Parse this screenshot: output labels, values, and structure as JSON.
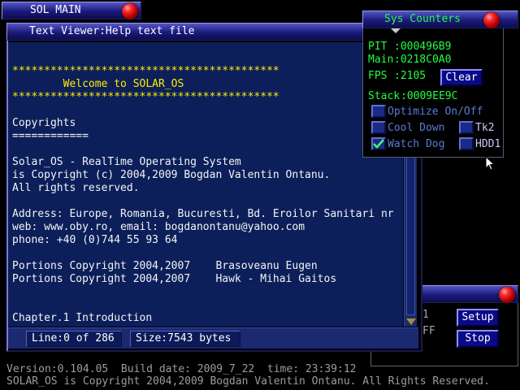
{
  "sol_main": {
    "title": "SOL MAIN"
  },
  "viewer": {
    "title": "Text Viewer:Help text file",
    "lines": [
      {
        "text": "******************************************",
        "color": "yellow"
      },
      {
        "text": "        Welcome to SOLAR_OS",
        "color": "yellow"
      },
      {
        "text": "******************************************",
        "color": "yellow"
      },
      {
        "text": "",
        "color": "white"
      },
      {
        "text": "Copyrights",
        "color": "white"
      },
      {
        "text": "============",
        "color": "white"
      },
      {
        "text": "",
        "color": "white"
      },
      {
        "text": "Solar_OS - RealTime Operating System",
        "color": "white"
      },
      {
        "text": "is Copyright (c) 2004,2009 Bogdan Valentin Ontanu.",
        "color": "white"
      },
      {
        "text": "All rights reserved.",
        "color": "white"
      },
      {
        "text": "",
        "color": "white"
      },
      {
        "text": "Address: Europe, Romania, Bucuresti, Bd. Eroilor Sanitari nr",
        "color": "white"
      },
      {
        "text": "web: www.oby.ro, email: bogdanontanu@yahoo.com",
        "color": "white"
      },
      {
        "text": "phone: +40 (0)744 55 93 64",
        "color": "white"
      },
      {
        "text": "",
        "color": "white"
      },
      {
        "text": "Portions Copyright 2004,2007    Brasoveanu Eugen",
        "color": "white"
      },
      {
        "text": "Portions Copyright 2004,2007    Hawk - Mihai Gaitos",
        "color": "white"
      },
      {
        "text": "",
        "color": "white"
      },
      {
        "text": "",
        "color": "white"
      },
      {
        "text": "Chapter.1 Introduction",
        "color": "white"
      }
    ],
    "status": {
      "line": "Line:0 of 286",
      "size": "Size:7543 bytes"
    }
  },
  "sys_counters": {
    "title": "Sys Counters",
    "pit_label": "PIT",
    "pit_value": ":000496B9",
    "main_label": "Main",
    "main_value": ":0218C0A0",
    "fps_label": "FPS",
    "fps_value": ":2105",
    "clear_label": "Clear",
    "stack_label": "Stack",
    "stack_value": ":0009EE9C",
    "options": {
      "optimize": {
        "label": "Optimize On/Off",
        "checked": false
      },
      "cool_down": {
        "label": "Cool Down",
        "checked": false
      },
      "watch_dog": {
        "label": "Watch Dog",
        "checked": true
      },
      "tk2": {
        "label": "Tk2",
        "checked": false
      },
      "hdd1": {
        "label": "HDD1",
        "checked": false
      }
    }
  },
  "bottom_right": {
    "partial_1": "1",
    "partial_2": "FF",
    "setup_label": "Setup",
    "stop_label": "Stop"
  },
  "footer": {
    "line1": "Version:0.104.05  Build date: 2009_7_22  time: 23:39:12",
    "line2": "SOLAR_OS is Copyright 2004,2009 Bogdan Valentin Ontanu. All Rights Reserved."
  }
}
